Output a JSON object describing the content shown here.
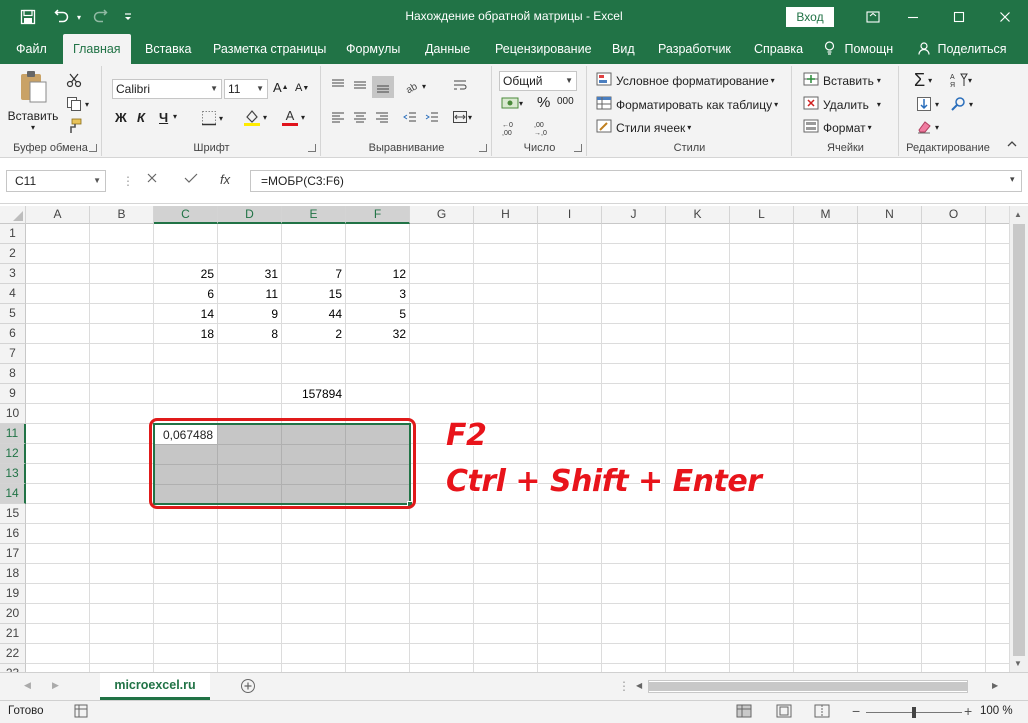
{
  "window": {
    "title": "Нахождение обратной матрицы  -  Excel",
    "login_label": "Вход",
    "accent_color": "#217346"
  },
  "quick_access": {
    "icons": [
      "save-icon",
      "undo-icon",
      "redo-icon",
      "customize-icon"
    ]
  },
  "tabs": [
    "Файл",
    "Главная",
    "Вставка",
    "Разметка страницы",
    "Формулы",
    "Данные",
    "Рецензирование",
    "Вид",
    "Разработчик",
    "Справка",
    "Помощн",
    "Поделиться"
  ],
  "ribbon": {
    "clipboard": {
      "paste_label": "Вставить",
      "group_label": "Буфер обмена"
    },
    "font": {
      "font_name": "Calibri",
      "font_size": "11",
      "bold": "Ж",
      "italic": "К",
      "underline": "Ч",
      "group_label": "Шрифт"
    },
    "alignment": {
      "group_label": "Выравнивание"
    },
    "number": {
      "format": "Общий",
      "percent": "%",
      "thousands": "000",
      "group_label": "Число"
    },
    "styles": {
      "conditional": "Условное форматирование",
      "as_table": "Форматировать как таблицу",
      "cell_styles": "Стили ячеек",
      "group_label": "Стили"
    },
    "cells": {
      "insert": "Вставить",
      "delete": "Удалить",
      "format": "Формат",
      "group_label": "Ячейки"
    },
    "editing": {
      "group_label": "Редактирование"
    }
  },
  "formula_bar": {
    "name_box": "C11",
    "formula": "=МОБР(C3:F6)"
  },
  "grid": {
    "columns": [
      "A",
      "B",
      "C",
      "D",
      "E",
      "F",
      "G",
      "H",
      "I",
      "J",
      "K",
      "L",
      "M",
      "N",
      "O"
    ],
    "rows": [
      "1",
      "2",
      "3",
      "4",
      "5",
      "6",
      "7",
      "8",
      "9",
      "10",
      "11",
      "12",
      "13",
      "14",
      "15",
      "16",
      "17",
      "18",
      "19",
      "20",
      "21",
      "22",
      "23"
    ],
    "matrix": [
      [
        "25",
        "31",
        "7",
        "12"
      ],
      [
        "6",
        "11",
        "15",
        "3"
      ],
      [
        "14",
        "9",
        "44",
        "5"
      ],
      [
        "18",
        "8",
        "2",
        "32"
      ]
    ],
    "e9": "157894",
    "c11": "0,067488"
  },
  "annotation": {
    "line1": "F2",
    "line2": "Ctrl + Shift + Enter"
  },
  "sheet_tab": "microexcel.ru",
  "status": {
    "ready": "Готово",
    "zoom": "100 %"
  }
}
